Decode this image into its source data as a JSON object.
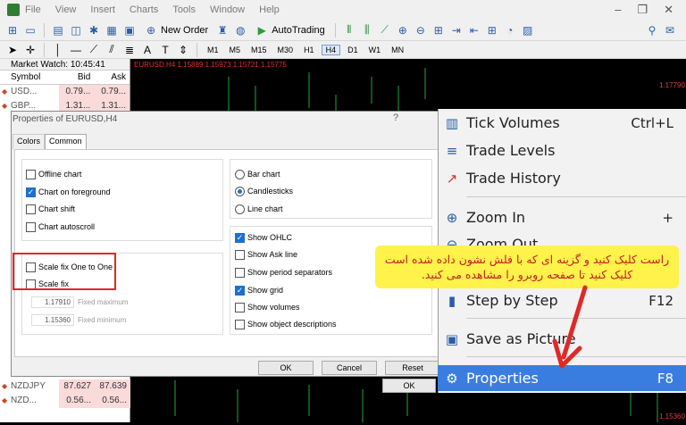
{
  "menubar": [
    "File",
    "View",
    "Insert",
    "Charts",
    "Tools",
    "Window",
    "Help"
  ],
  "toolbar": {
    "new_order": "New Order",
    "autotrading": "AutoTrading"
  },
  "timeframes": [
    "M1",
    "M5",
    "M15",
    "M30",
    "H1",
    "H4",
    "D1",
    "W1",
    "MN"
  ],
  "active_timeframe": "H4",
  "market_watch": {
    "title": "Market Watch: 10:45:41",
    "columns": [
      "Symbol",
      "Bid",
      "Ask"
    ],
    "rows": [
      {
        "symbol": "USD...",
        "bid": "0.79...",
        "ask": "0.79..."
      },
      {
        "symbol": "GBP...",
        "bid": "1.31...",
        "ask": "1.31..."
      }
    ],
    "bottom_rows": [
      {
        "symbol": "NZDJPY",
        "bid": "87.627",
        "ask": "87.639"
      },
      {
        "symbol": "NZD...",
        "bid": "0.56...",
        "ask": "0.56..."
      }
    ]
  },
  "chart": {
    "title": "EURUSD,H4  1.15889 1.15973 1.15721 1.15775",
    "price_top": "1.17790",
    "price_bottom": "1.15360"
  },
  "dialog": {
    "title": "Properties of EURUSD,H4",
    "help": "?",
    "tabs": [
      "Colors",
      "Common"
    ],
    "left_options": [
      {
        "label": "Offline chart",
        "checked": false
      },
      {
        "label": "Chart on foreground",
        "checked": true
      },
      {
        "label": "Chart shift",
        "checked": false
      },
      {
        "label": "Chart autoscroll",
        "checked": false
      }
    ],
    "scale_options": [
      {
        "label": "Scale fix One to One",
        "checked": false
      },
      {
        "label": "Scale fix",
        "checked": false
      }
    ],
    "fixed_max": {
      "value": "1.17910",
      "label": "Fixed maximum"
    },
    "fixed_min": {
      "value": "1.15360",
      "label": "Fixed minimum"
    },
    "chart_types": [
      {
        "label": "Bar chart",
        "selected": false
      },
      {
        "label": "Candlesticks",
        "selected": true
      },
      {
        "label": "Line chart",
        "selected": false
      }
    ],
    "show_options": [
      {
        "label": "Show OHLC",
        "checked": true
      },
      {
        "label": "Show Ask line",
        "checked": false
      },
      {
        "label": "Show period separators",
        "checked": false
      },
      {
        "label": "Show grid",
        "checked": true
      },
      {
        "label": "Show volumes",
        "checked": false
      },
      {
        "label": "Show object descriptions",
        "checked": false
      }
    ],
    "buttons": {
      "ok": "OK",
      "cancel": "Cancel",
      "reset": "Reset"
    }
  },
  "context_menu": [
    {
      "label": "Tick Volumes",
      "shortcut": "Ctrl+L",
      "icon": "tick-volumes-icon"
    },
    {
      "label": "Trade Levels",
      "shortcut": "",
      "icon": "trade-levels-icon"
    },
    {
      "label": "Trade History",
      "shortcut": "",
      "icon": "trade-history-icon"
    },
    {
      "label": "Zoom In",
      "shortcut": "+",
      "icon": "zoom-in-icon"
    },
    {
      "label": "Zoom Out",
      "shortcut": "",
      "icon": "zoom-out-icon"
    },
    {
      "label": "Step by Step",
      "shortcut": "F12",
      "icon": "step-icon"
    },
    {
      "label": "Save as Picture",
      "shortcut": "",
      "icon": "picture-icon"
    },
    {
      "label": "Properties",
      "shortcut": "F8",
      "icon": "gear-icon"
    }
  ],
  "context_ok": "OK",
  "callout_text": "راست کلیک کنید و گزینه ای که با فلش نشون داده شده است کلیک کنید تا صفحه روبرو را مشاهده می کنید.",
  "colors": {
    "highlight": "#3a7de0",
    "callout_bg": "#fff24a",
    "callout_text": "#c02020",
    "annotation": "#e02828"
  }
}
